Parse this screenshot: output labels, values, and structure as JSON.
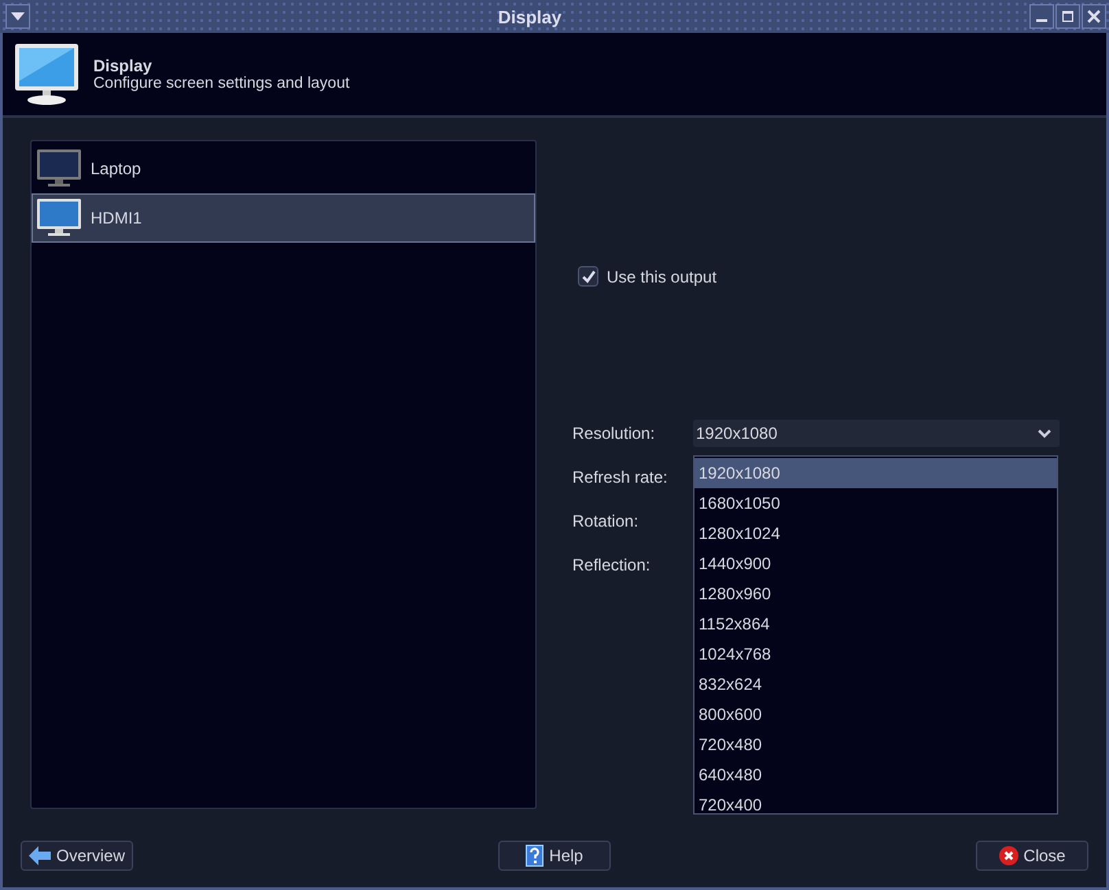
{
  "window": {
    "title": "Display"
  },
  "header": {
    "title": "Display",
    "subtitle": "Configure screen settings and layout"
  },
  "outputs": [
    {
      "name": "Laptop",
      "selected": false
    },
    {
      "name": "HDMI1",
      "selected": true
    }
  ],
  "use_output": {
    "label": "Use this output",
    "checked": true
  },
  "resolution": {
    "label": "Resolution:",
    "value": "1920x1080",
    "expanded": true,
    "options": [
      {
        "label": "1920x1080",
        "selected": true
      },
      {
        "label": "1680x1050",
        "selected": false
      },
      {
        "label": "1280x1024",
        "selected": false
      },
      {
        "label": "1440x900",
        "selected": false
      },
      {
        "label": "1280x960",
        "selected": false
      },
      {
        "label": "1152x864",
        "selected": false
      },
      {
        "label": "1024x768",
        "selected": false
      },
      {
        "label": "832x624",
        "selected": false
      },
      {
        "label": "800x600",
        "selected": false
      },
      {
        "label": "720x480",
        "selected": false
      },
      {
        "label": "640x480",
        "selected": false
      },
      {
        "label": "720x400",
        "selected": false
      }
    ]
  },
  "other_fields": [
    {
      "label": "Refresh rate:"
    },
    {
      "label": "Rotation:"
    },
    {
      "label": "Reflection:"
    }
  ],
  "buttons": [
    {
      "kind": "back",
      "label": "Overview"
    },
    {
      "kind": "help",
      "label": "Help"
    },
    {
      "kind": "close",
      "label": "Close"
    }
  ]
}
